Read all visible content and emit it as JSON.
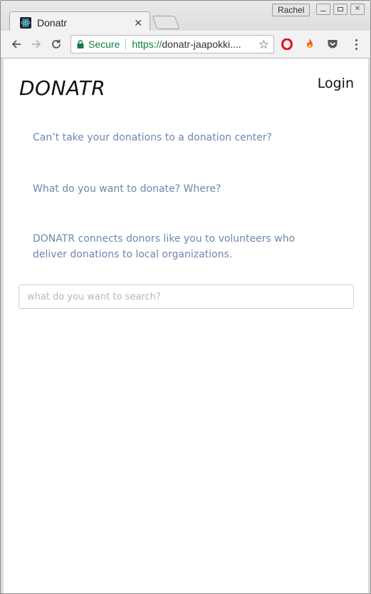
{
  "browser": {
    "profile_name": "Rachel",
    "tab": {
      "title": "Donatr",
      "favicon": "react-atom-icon",
      "close_glyph": "✕"
    },
    "address_bar": {
      "security_label": "Secure",
      "url_scheme": "https://",
      "url_rest": "donatr-jaapokki...."
    },
    "icons": {
      "back": "back-arrow-icon",
      "forward": "forward-arrow-icon",
      "reload": "reload-icon",
      "bookmark": "star-icon",
      "extension_1": "opera-icon",
      "extension_2": "fire-icon",
      "extension_3": "pocket-icon",
      "menu": "more-vert-icon"
    }
  },
  "page": {
    "logo": "DONATR",
    "login_label": "Login",
    "taglines": [
      "Can’t take your donations to a donation center?",
      "What do you want to donate? Where?",
      "DONATR connects donors like you to volunteers who deliver donations to local organizations."
    ],
    "search": {
      "placeholder": "what do you want to search?",
      "value": ""
    }
  },
  "colors": {
    "tagline": "#6f87b0",
    "secure_green": "#0b8043",
    "logo": "#111111"
  }
}
